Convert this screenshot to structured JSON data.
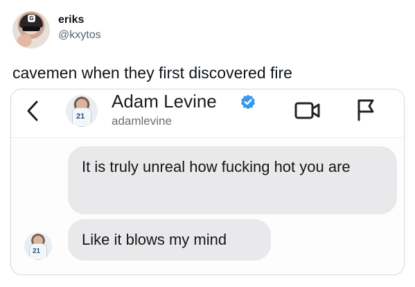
{
  "tweet": {
    "display_name": "eriks",
    "handle": "@kxytos",
    "text": "cavemen when they first discovered fire"
  },
  "screenshot": {
    "contact_name": "Adam Levine",
    "contact_handle": "adamlevine",
    "avatar_number": "21",
    "messages": [
      "It is truly unreal how fucking hot you are",
      "Like it blows my mind"
    ],
    "icons": [
      "back-chevron-icon",
      "verified-badge-icon",
      "video-call-icon",
      "report-flag-icon"
    ],
    "colors": {
      "verified": "#3897f0",
      "bubble": "#e9e9eb"
    }
  }
}
